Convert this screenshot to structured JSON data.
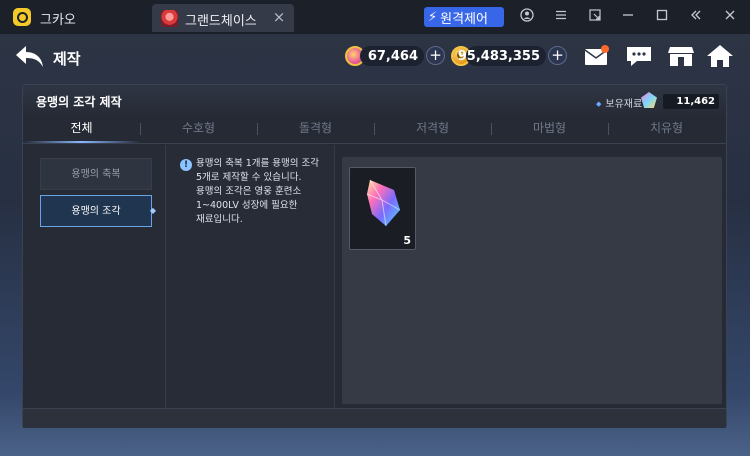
{
  "titlebar": {
    "app_name": "그카오",
    "tab_label": "그랜드체이스",
    "tab_close": "×",
    "remote_label": "원격제어"
  },
  "game": {
    "page_title": "제작",
    "currency": {
      "gems": "67,464",
      "gold": "95,483,355",
      "gold_symbol": "G",
      "plus": "+"
    }
  },
  "panel": {
    "title": "용맹의 조각 제작",
    "material_label": "보유재료",
    "material_count": "11,462",
    "tabs": [
      {
        "label": "전체"
      },
      {
        "label": "수호형"
      },
      {
        "label": "돌격형"
      },
      {
        "label": "저격형"
      },
      {
        "label": "마법형"
      },
      {
        "label": "치유형"
      }
    ],
    "list": [
      {
        "label": "용맹의 축복"
      },
      {
        "label": "용맹의 조각"
      }
    ],
    "info_icon": "!",
    "info_lines": [
      "용맹의 축복 1개를 용맹의 조각",
      "5개로 제작할 수 있습니다.",
      "용맹의 조각은 영웅 훈련소",
      "1~400LV 성장에 필요한",
      "재료입니다."
    ],
    "item": {
      "qty": "5"
    }
  },
  "colors": {
    "accent": "#3766e8",
    "selected_border": "#6aa3e6"
  }
}
